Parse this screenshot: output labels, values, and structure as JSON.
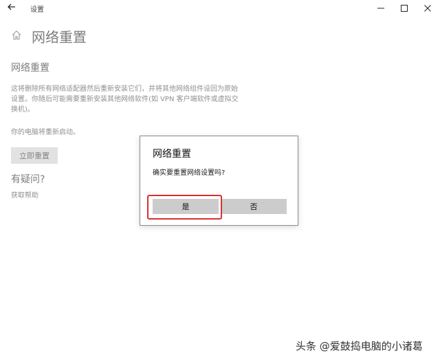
{
  "window": {
    "title": "设置",
    "back_icon": "back-arrow-icon",
    "controls": [
      "minimize-icon",
      "maximize-icon",
      "close-icon"
    ]
  },
  "page": {
    "title": "网络重置",
    "home_icon": "home-icon",
    "section_heading": "网络重置",
    "description": "这将删除所有网络适配器然后重新安装它们，并将其他网络组件设回为原始设置。你随后可能需要重新安装其他网络软件(如 VPN 客户端软件或虚拟交换机)。",
    "restart_note": "你的电脑将重新启动。",
    "reset_button": "立即重置",
    "help_heading": "有疑问?",
    "help_link": "获取帮助"
  },
  "dialog": {
    "title": "网络重置",
    "message": "确实要重置网络设置吗?",
    "yes_button": "是",
    "no_button": "否",
    "highlight_color": "#d9302f"
  },
  "watermark": "头条 @爱鼓捣电脑的小诸葛"
}
